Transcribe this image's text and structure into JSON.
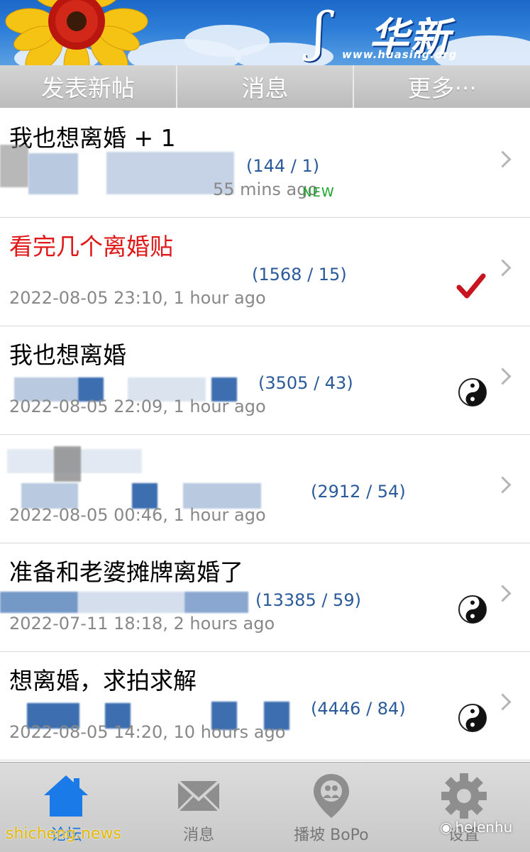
{
  "banner": {
    "logo_text": "华新",
    "logo_url": "www.huasing.org"
  },
  "toolbar": {
    "new_post": "发表新帖",
    "messages": "消息",
    "more": "更多···"
  },
  "threads": [
    {
      "title": "我也想离婚 + 1",
      "counts": "(144 / 1)",
      "time": "mins ago",
      "time_prefix": "55",
      "badge": "NEW",
      "title_color": "#000000",
      "status": "none"
    },
    {
      "title": "看完几个离婚贴",
      "counts": "(1568 / 15)",
      "time": "2022-08-05 23:10, 1 hour ago",
      "title_color": "#e01818",
      "status": "check"
    },
    {
      "title": "我也想离婚",
      "counts": "(3505 / 43)",
      "time": "2022-08-05 22:09, 1 hour ago",
      "title_color": "#000000",
      "status": "yin-yang"
    },
    {
      "title": "",
      "counts": "(2912 / 54)",
      "time": "2022-08-05 00:46, 1 hour ago",
      "title_color": "#000000",
      "status": "none"
    },
    {
      "title": "准备和老婆摊牌离婚了",
      "counts": "(13385 / 59)",
      "time": "2022-07-11 18:18, 2 hours ago",
      "title_color": "#000000",
      "status": "yin-yang"
    },
    {
      "title": "想离婚，求拍求解",
      "counts": "(4446 / 84)",
      "time": "2022-08-05 14:20, 10 hours ago",
      "title_color": "#000000",
      "status": "yin-yang"
    }
  ],
  "tabbar": {
    "forum": "论坛",
    "messages": "消息",
    "bopo": "播坡 BoPo",
    "settings": "设置",
    "active_color": "#1a6fd8"
  },
  "watermarks": {
    "left": "shicheng.news",
    "right": "helenhu"
  }
}
